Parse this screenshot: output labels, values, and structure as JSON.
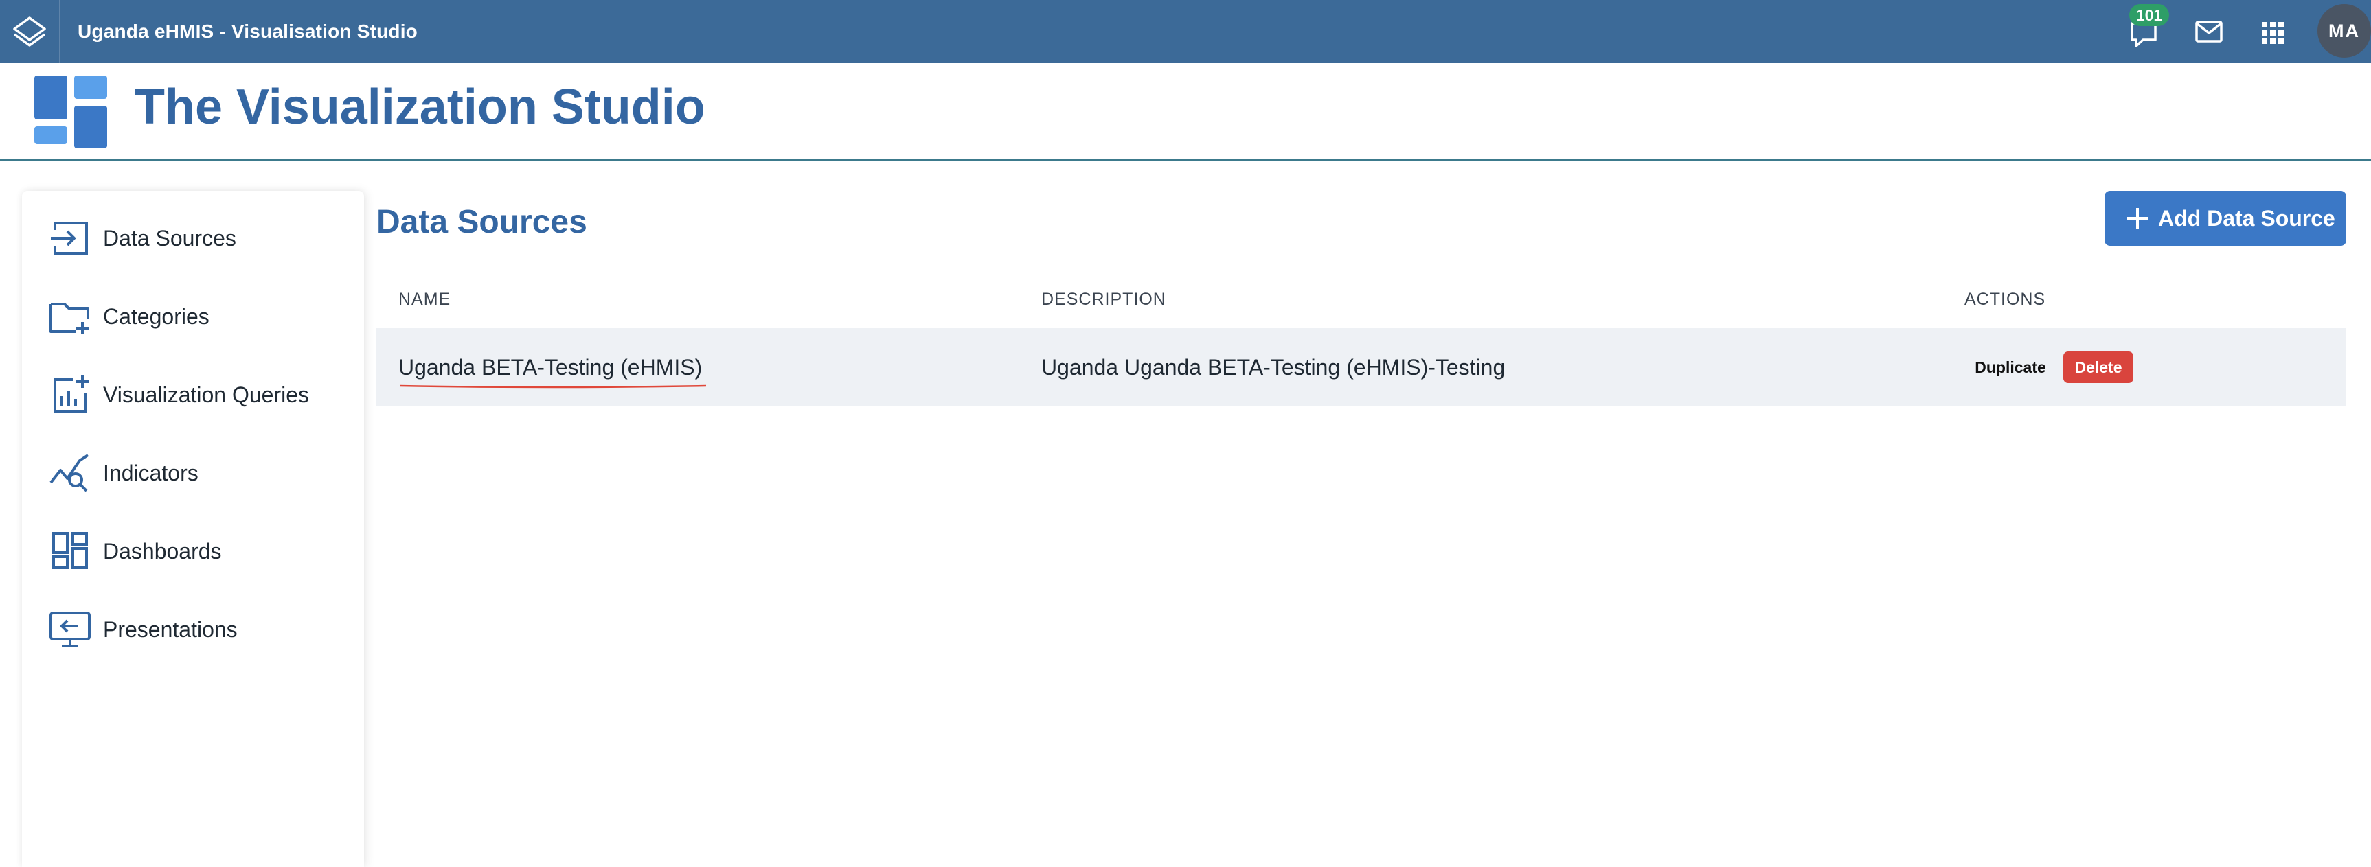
{
  "topbar": {
    "app_title": "Uganda eHMIS - Visualisation Studio",
    "notification_count": "101",
    "user_initials": "MA",
    "icons": [
      "dhis2-logo-icon",
      "message-icon",
      "mail-icon",
      "apps-grid-icon"
    ]
  },
  "header": {
    "title": "The Visualization Studio",
    "logo_icon": "dashboard-logo-icon"
  },
  "sidebar": {
    "items": [
      {
        "label": "Data Sources",
        "icon": "data-source-icon"
      },
      {
        "label": "Categories",
        "icon": "folder-add-icon"
      },
      {
        "label": "Visualization Queries",
        "icon": "chart-add-icon"
      },
      {
        "label": "Indicators",
        "icon": "trend-search-icon"
      },
      {
        "label": "Dashboards",
        "icon": "dashboard-icon"
      },
      {
        "label": "Presentations",
        "icon": "presentation-icon"
      }
    ]
  },
  "main": {
    "title": "Data Sources",
    "add_button_label": "Add Data Source",
    "table": {
      "columns": [
        "NAME",
        "DESCRIPTION",
        "ACTIONS"
      ],
      "rows": [
        {
          "name": "Uganda BETA-Testing (eHMIS)",
          "description": "Uganda Uganda BETA-Testing (eHMIS)-Testing",
          "actions": {
            "duplicate": "Duplicate",
            "delete": "Delete"
          }
        }
      ]
    }
  },
  "colors": {
    "topbar": "#3c6a98",
    "title_blue": "#3466a2",
    "button_blue": "#3b78c6",
    "delete_red": "#d9443d",
    "badge_green": "#2e9e67",
    "row_bg": "#eef1f5"
  }
}
